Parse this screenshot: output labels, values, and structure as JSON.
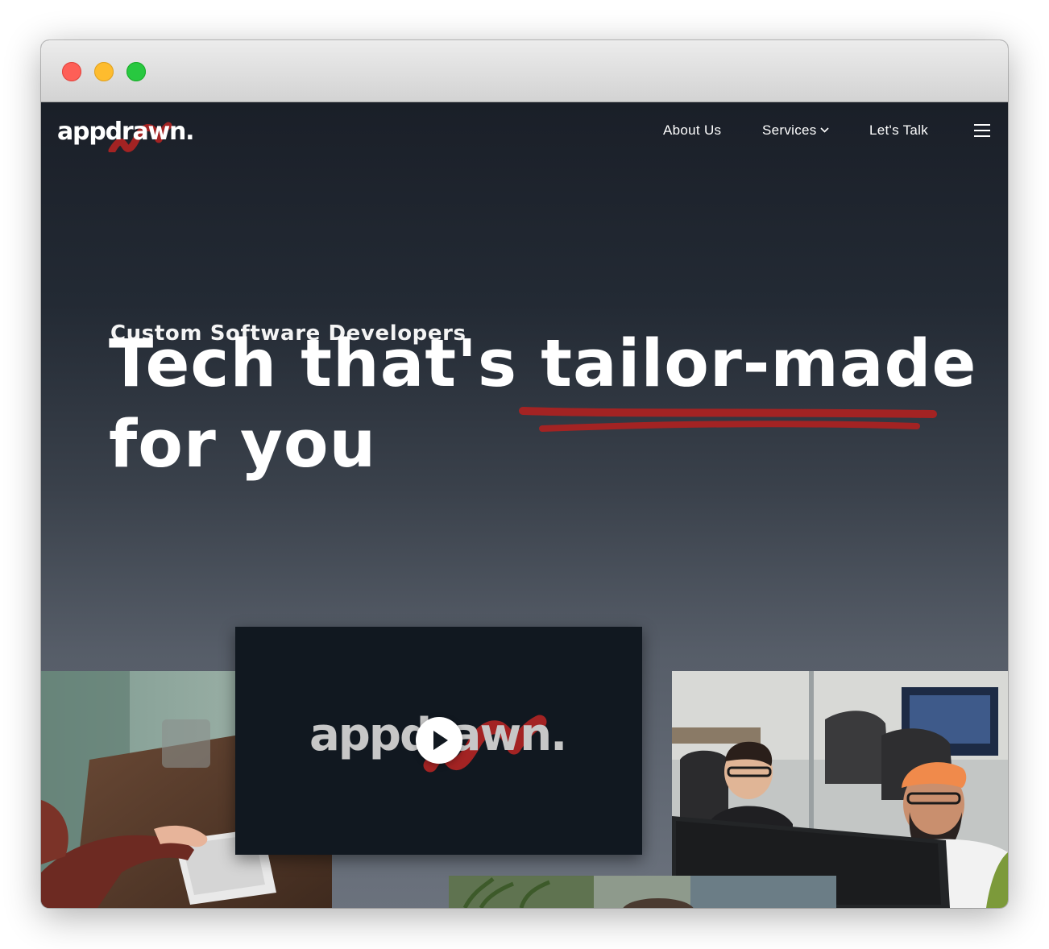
{
  "brand": {
    "logo_text": "appdrawn.",
    "accent_color": "#a32323",
    "nav_bg": "#1b1f27"
  },
  "nav": {
    "items": [
      {
        "label": "About Us"
      },
      {
        "label": "Services",
        "has_dropdown": true
      },
      {
        "label": "Let's Talk"
      }
    ],
    "menu_icon": "hamburger-menu-icon"
  },
  "hero": {
    "eyebrow": "Custom Software Developers",
    "headline_part1": "Tech that's ",
    "headline_highlight": "tailor-made",
    "headline_part2": "for you"
  },
  "video": {
    "logo_text": "appdrawn.",
    "play_icon": "play-icon"
  },
  "window": {
    "controls": [
      "close",
      "minimize",
      "zoom"
    ]
  }
}
